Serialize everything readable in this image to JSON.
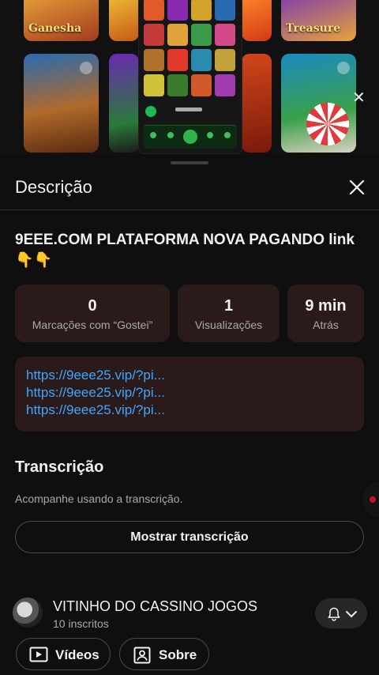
{
  "video_preview": {
    "tiles": [
      {
        "label": "Ganesha"
      },
      {
        "label": ""
      },
      {
        "label": ""
      },
      {
        "label": ""
      },
      {
        "label": ""
      },
      {
        "label": ""
      },
      {
        "label": "Treasure"
      },
      {
        "label": ""
      }
    ]
  },
  "sheet": {
    "title": "Descrição",
    "close_icon": "close-icon"
  },
  "video": {
    "title": "9EEE.COM PLATAFORMA NOVA PAGANDO link 👇👇"
  },
  "stats": [
    {
      "value": "0",
      "label": "Marcações com “Gostei”"
    },
    {
      "value": "1",
      "label": "Visualizações"
    },
    {
      "value": "9 min",
      "label": "Atrás"
    }
  ],
  "links": [
    "https://9eee25.vip/?pi...",
    "https://9eee25.vip/?pi...",
    "https://9eee25.vip/?pi..."
  ],
  "transcript": {
    "title": "Transcrição",
    "subtitle": "Acompanhe usando a transcrição.",
    "button_label": "Mostrar transcrição"
  },
  "channel": {
    "name": "VITINHO DO CASSINO JOGOS",
    "subscribers": "10 inscritos",
    "buttons": [
      {
        "label": "Vídeos",
        "icon": "video-icon"
      },
      {
        "label": "Sobre",
        "icon": "profile-icon"
      }
    ]
  },
  "colors": {
    "background": "#0f0f0f",
    "card": "#2a1b1a",
    "link": "#3ea6ff",
    "secondary_text": "#aaaaaa"
  }
}
